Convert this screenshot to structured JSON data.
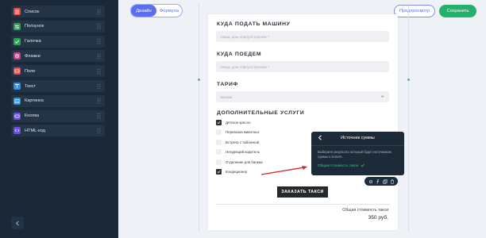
{
  "sidebar": {
    "items": [
      {
        "label": "Список",
        "icon": "list-icon",
        "color": "#e94949"
      },
      {
        "label": "Ползунок",
        "icon": "slider-icon",
        "color": "#2ea44f"
      },
      {
        "label": "Галочка",
        "icon": "checkbox-icon",
        "color": "#2ea44f"
      },
      {
        "label": "Флажки",
        "icon": "radio-icon",
        "color": "#c2408e"
      },
      {
        "label": "Поле",
        "icon": "field-icon",
        "color": "#e94949"
      },
      {
        "label": "Текст",
        "icon": "text-icon",
        "color": "#3a8ee6"
      },
      {
        "label": "Картинка",
        "icon": "image-icon",
        "color": "#2f93d8"
      },
      {
        "label": "Кнопка",
        "icon": "button-icon",
        "color": "#6c4fd8"
      },
      {
        "label": "HTML-код",
        "icon": "code-icon",
        "color": "#6c4fd8"
      }
    ]
  },
  "toolbar": {
    "mode_design": "Дизайн",
    "mode_formula": "Формула",
    "preview": "Предпросмотр",
    "save": "Сохранить",
    "accent": "#5b6ef0",
    "save_color": "#25b06b"
  },
  "form": {
    "where_title": "КУДА ПОДАТЬ МАШИНУ",
    "where_placeholder": "Улица, дом, корпус/строение *",
    "dest_title": "КУДА ПОЕДЕМ",
    "dest_placeholder": "Улица, дом, корпус/строение *",
    "tariff_title": "ТАРИФ",
    "tariff_value": "Эконом",
    "services_title": "ДОПОЛНИТЕЛЬНЫЕ УСЛУГИ",
    "services": [
      {
        "label": "Детское кресло",
        "checked": true
      },
      {
        "label": "Перевозка животных",
        "checked": false
      },
      {
        "label": "Встреча с табличкой",
        "checked": false
      },
      {
        "label": "Некурящий водитель",
        "checked": false
      },
      {
        "label": "Отделение для багажа",
        "checked": false
      },
      {
        "label": "Кондиционер",
        "checked": true
      }
    ],
    "submit": "ЗАКАЗАТЬ ТАКСИ",
    "total_label": "Общая стоимость такси",
    "total_value": "350 руб."
  },
  "popup": {
    "title": "Источник суммы",
    "description": "Выберите результат, который будет источником суммы к оплате.",
    "option": "Общая стоимость такси"
  }
}
